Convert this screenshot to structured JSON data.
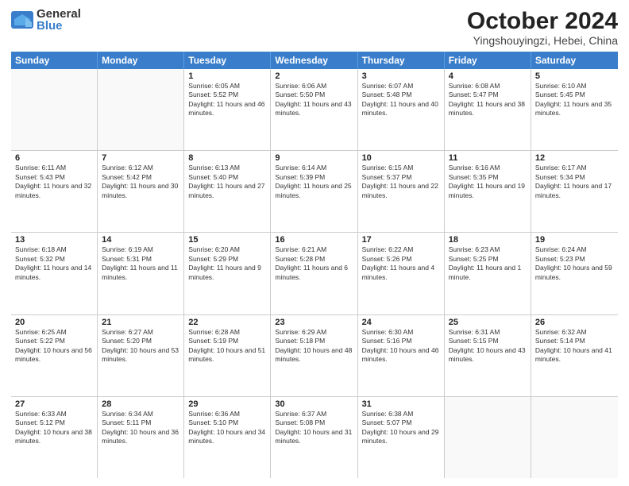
{
  "header": {
    "logo_general": "General",
    "logo_blue": "Blue",
    "month_title": "October 2024",
    "subtitle": "Yingshouyingzi, Hebei, China"
  },
  "days_of_week": [
    "Sunday",
    "Monday",
    "Tuesday",
    "Wednesday",
    "Thursday",
    "Friday",
    "Saturday"
  ],
  "weeks": [
    [
      {
        "day": "",
        "sunrise": "",
        "sunset": "",
        "daylight": ""
      },
      {
        "day": "",
        "sunrise": "",
        "sunset": "",
        "daylight": ""
      },
      {
        "day": "1",
        "sunrise": "Sunrise: 6:05 AM",
        "sunset": "Sunset: 5:52 PM",
        "daylight": "Daylight: 11 hours and 46 minutes."
      },
      {
        "day": "2",
        "sunrise": "Sunrise: 6:06 AM",
        "sunset": "Sunset: 5:50 PM",
        "daylight": "Daylight: 11 hours and 43 minutes."
      },
      {
        "day": "3",
        "sunrise": "Sunrise: 6:07 AM",
        "sunset": "Sunset: 5:48 PM",
        "daylight": "Daylight: 11 hours and 40 minutes."
      },
      {
        "day": "4",
        "sunrise": "Sunrise: 6:08 AM",
        "sunset": "Sunset: 5:47 PM",
        "daylight": "Daylight: 11 hours and 38 minutes."
      },
      {
        "day": "5",
        "sunrise": "Sunrise: 6:10 AM",
        "sunset": "Sunset: 5:45 PM",
        "daylight": "Daylight: 11 hours and 35 minutes."
      }
    ],
    [
      {
        "day": "6",
        "sunrise": "Sunrise: 6:11 AM",
        "sunset": "Sunset: 5:43 PM",
        "daylight": "Daylight: 11 hours and 32 minutes."
      },
      {
        "day": "7",
        "sunrise": "Sunrise: 6:12 AM",
        "sunset": "Sunset: 5:42 PM",
        "daylight": "Daylight: 11 hours and 30 minutes."
      },
      {
        "day": "8",
        "sunrise": "Sunrise: 6:13 AM",
        "sunset": "Sunset: 5:40 PM",
        "daylight": "Daylight: 11 hours and 27 minutes."
      },
      {
        "day": "9",
        "sunrise": "Sunrise: 6:14 AM",
        "sunset": "Sunset: 5:39 PM",
        "daylight": "Daylight: 11 hours and 25 minutes."
      },
      {
        "day": "10",
        "sunrise": "Sunrise: 6:15 AM",
        "sunset": "Sunset: 5:37 PM",
        "daylight": "Daylight: 11 hours and 22 minutes."
      },
      {
        "day": "11",
        "sunrise": "Sunrise: 6:16 AM",
        "sunset": "Sunset: 5:35 PM",
        "daylight": "Daylight: 11 hours and 19 minutes."
      },
      {
        "day": "12",
        "sunrise": "Sunrise: 6:17 AM",
        "sunset": "Sunset: 5:34 PM",
        "daylight": "Daylight: 11 hours and 17 minutes."
      }
    ],
    [
      {
        "day": "13",
        "sunrise": "Sunrise: 6:18 AM",
        "sunset": "Sunset: 5:32 PM",
        "daylight": "Daylight: 11 hours and 14 minutes."
      },
      {
        "day": "14",
        "sunrise": "Sunrise: 6:19 AM",
        "sunset": "Sunset: 5:31 PM",
        "daylight": "Daylight: 11 hours and 11 minutes."
      },
      {
        "day": "15",
        "sunrise": "Sunrise: 6:20 AM",
        "sunset": "Sunset: 5:29 PM",
        "daylight": "Daylight: 11 hours and 9 minutes."
      },
      {
        "day": "16",
        "sunrise": "Sunrise: 6:21 AM",
        "sunset": "Sunset: 5:28 PM",
        "daylight": "Daylight: 11 hours and 6 minutes."
      },
      {
        "day": "17",
        "sunrise": "Sunrise: 6:22 AM",
        "sunset": "Sunset: 5:26 PM",
        "daylight": "Daylight: 11 hours and 4 minutes."
      },
      {
        "day": "18",
        "sunrise": "Sunrise: 6:23 AM",
        "sunset": "Sunset: 5:25 PM",
        "daylight": "Daylight: 11 hours and 1 minute."
      },
      {
        "day": "19",
        "sunrise": "Sunrise: 6:24 AM",
        "sunset": "Sunset: 5:23 PM",
        "daylight": "Daylight: 10 hours and 59 minutes."
      }
    ],
    [
      {
        "day": "20",
        "sunrise": "Sunrise: 6:25 AM",
        "sunset": "Sunset: 5:22 PM",
        "daylight": "Daylight: 10 hours and 56 minutes."
      },
      {
        "day": "21",
        "sunrise": "Sunrise: 6:27 AM",
        "sunset": "Sunset: 5:20 PM",
        "daylight": "Daylight: 10 hours and 53 minutes."
      },
      {
        "day": "22",
        "sunrise": "Sunrise: 6:28 AM",
        "sunset": "Sunset: 5:19 PM",
        "daylight": "Daylight: 10 hours and 51 minutes."
      },
      {
        "day": "23",
        "sunrise": "Sunrise: 6:29 AM",
        "sunset": "Sunset: 5:18 PM",
        "daylight": "Daylight: 10 hours and 48 minutes."
      },
      {
        "day": "24",
        "sunrise": "Sunrise: 6:30 AM",
        "sunset": "Sunset: 5:16 PM",
        "daylight": "Daylight: 10 hours and 46 minutes."
      },
      {
        "day": "25",
        "sunrise": "Sunrise: 6:31 AM",
        "sunset": "Sunset: 5:15 PM",
        "daylight": "Daylight: 10 hours and 43 minutes."
      },
      {
        "day": "26",
        "sunrise": "Sunrise: 6:32 AM",
        "sunset": "Sunset: 5:14 PM",
        "daylight": "Daylight: 10 hours and 41 minutes."
      }
    ],
    [
      {
        "day": "27",
        "sunrise": "Sunrise: 6:33 AM",
        "sunset": "Sunset: 5:12 PM",
        "daylight": "Daylight: 10 hours and 38 minutes."
      },
      {
        "day": "28",
        "sunrise": "Sunrise: 6:34 AM",
        "sunset": "Sunset: 5:11 PM",
        "daylight": "Daylight: 10 hours and 36 minutes."
      },
      {
        "day": "29",
        "sunrise": "Sunrise: 6:36 AM",
        "sunset": "Sunset: 5:10 PM",
        "daylight": "Daylight: 10 hours and 34 minutes."
      },
      {
        "day": "30",
        "sunrise": "Sunrise: 6:37 AM",
        "sunset": "Sunset: 5:08 PM",
        "daylight": "Daylight: 10 hours and 31 minutes."
      },
      {
        "day": "31",
        "sunrise": "Sunrise: 6:38 AM",
        "sunset": "Sunset: 5:07 PM",
        "daylight": "Daylight: 10 hours and 29 minutes."
      },
      {
        "day": "",
        "sunrise": "",
        "sunset": "",
        "daylight": ""
      },
      {
        "day": "",
        "sunrise": "",
        "sunset": "",
        "daylight": ""
      }
    ]
  ]
}
